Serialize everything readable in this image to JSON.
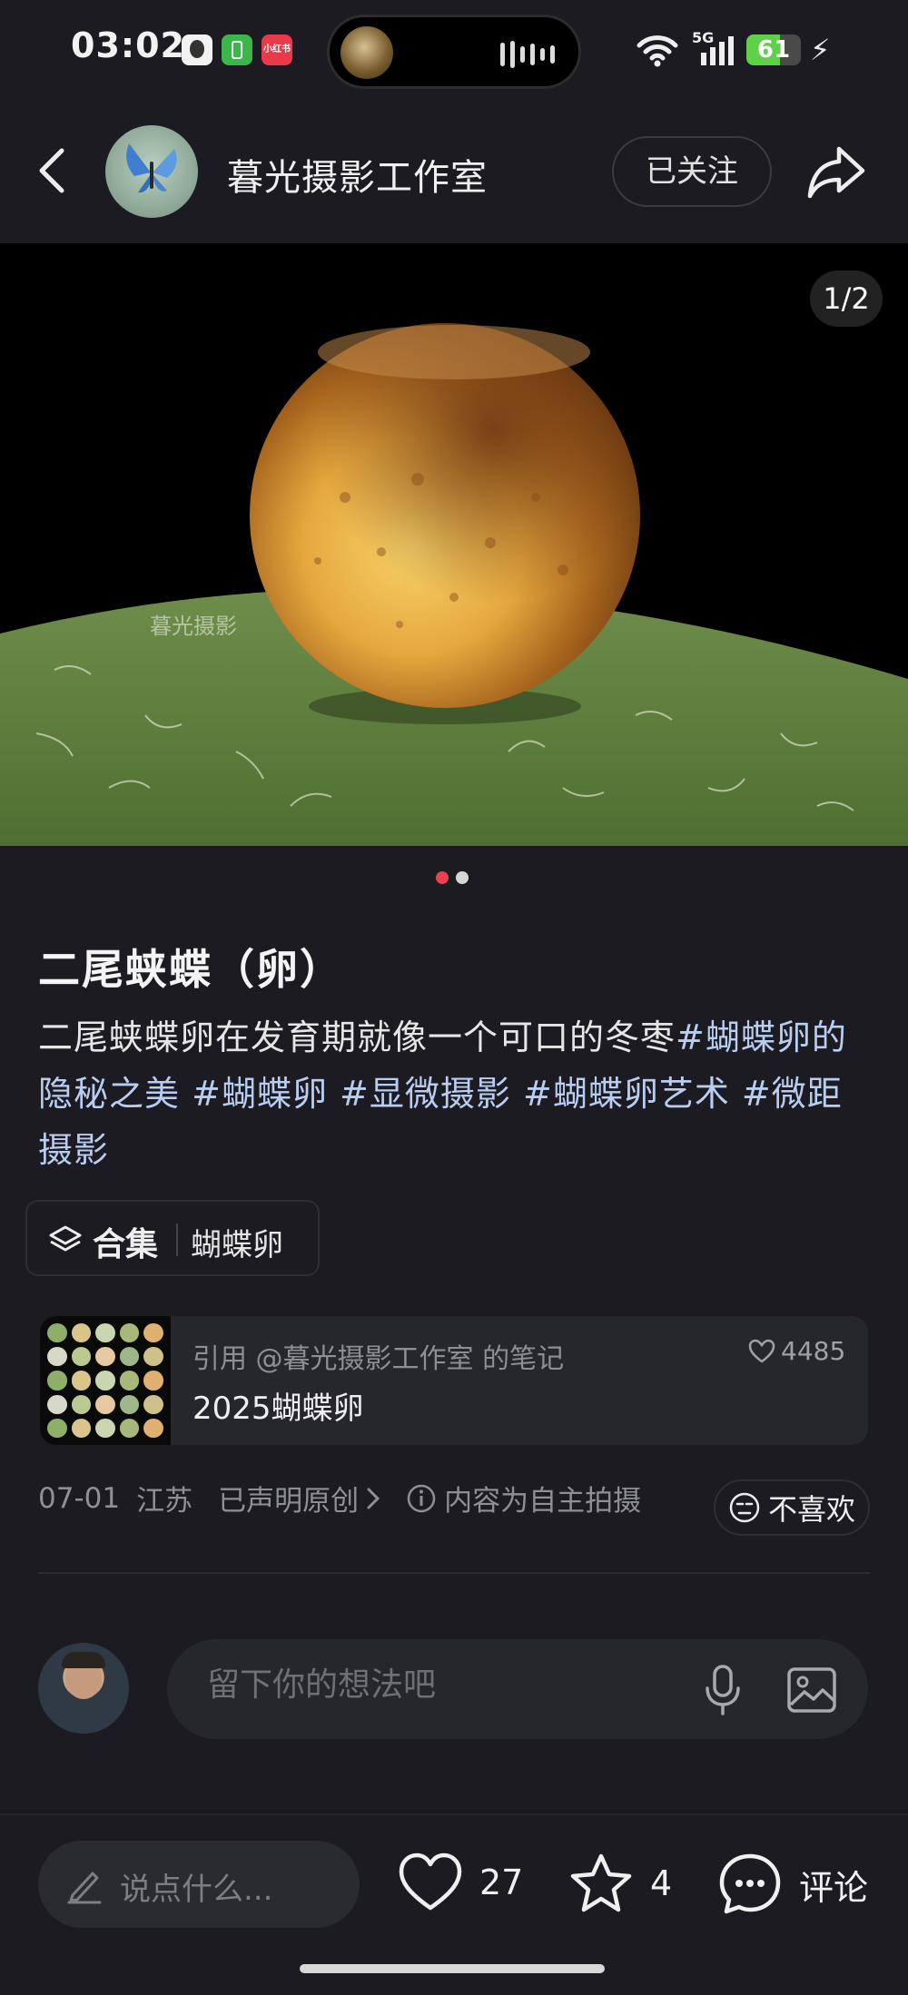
{
  "status_bar": {
    "time": "03:02",
    "battery_level": "61",
    "battery_fraction": 0.61,
    "network": "5G",
    "app_badge": "小红书"
  },
  "header": {
    "back_icon": "chevron-left-icon",
    "author_name": "暮光摄影工作室",
    "follow_label": "已关注",
    "share_icon": "share-icon"
  },
  "media": {
    "counter": "1/2",
    "watermark": "暮光摄影",
    "page_dots": [
      {
        "active": true
      },
      {
        "active": false
      }
    ],
    "colors": {
      "active_dot": "#e8424f",
      "inactive_dot": "#d6d6d6"
    }
  },
  "post": {
    "title": "二尾蛱蝶（卵）",
    "description_text": "二尾蛱蝶卵在发育期就像一个可口的冬枣",
    "tags": [
      "#蝴蝶卵的隐秘之美",
      "#蝴蝶卵",
      "#显微摄影",
      "#蝴蝶卵艺术",
      "#微距摄影"
    ]
  },
  "collection": {
    "label": "合集",
    "name": "蝴蝶卵"
  },
  "quote": {
    "ref_text": "引用 @暮光摄影工作室 的笔记",
    "title": "2025蝴蝶卵",
    "likes": "4485"
  },
  "meta": {
    "date": "07-01",
    "location": "江苏",
    "original": "已声明原创",
    "notice": "内容为自主拍摄",
    "dislike_label": "不喜欢"
  },
  "comment": {
    "placeholder": "留下你的想法吧"
  },
  "bottom_bar": {
    "say_placeholder": "说点什么...",
    "likes": "27",
    "favorites": "4",
    "comment_label": "评论"
  }
}
